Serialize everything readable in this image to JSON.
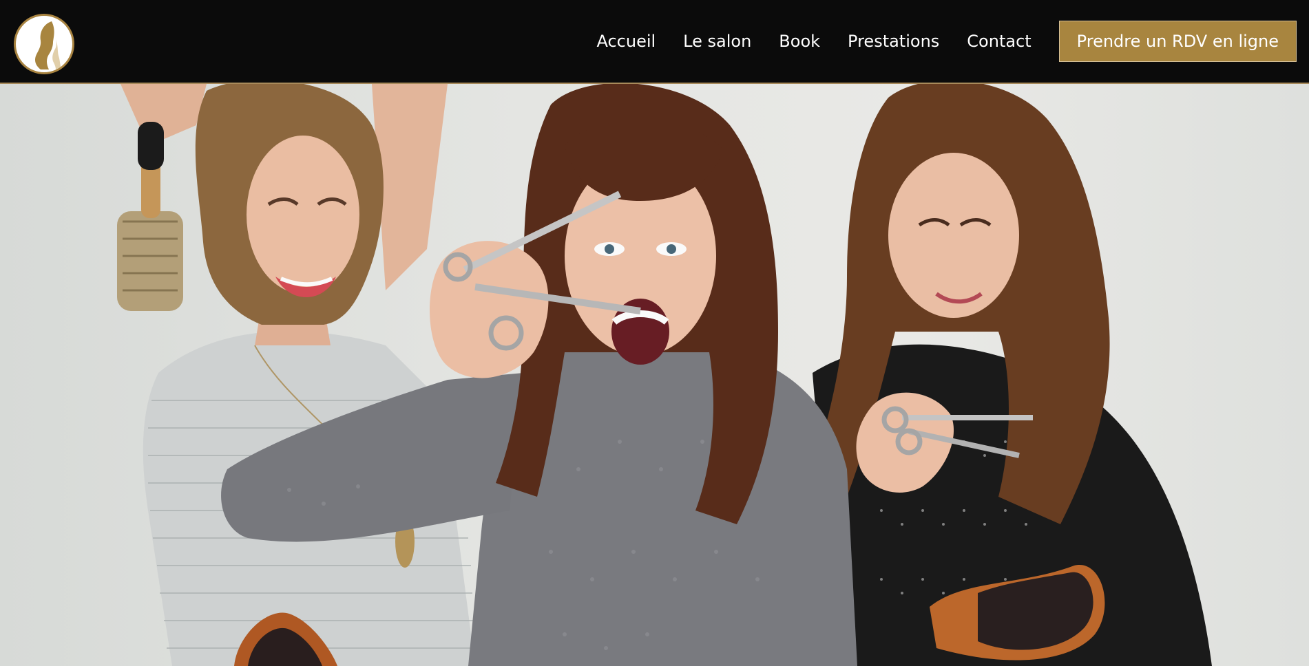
{
  "header": {
    "logo_name": "salon-logo-woman-profile",
    "nav": [
      {
        "label": "Accueil"
      },
      {
        "label": "Le salon"
      },
      {
        "label": "Book"
      },
      {
        "label": "Prestations"
      },
      {
        "label": "Contact"
      }
    ],
    "cta_label": "Prendre un RDV en ligne"
  },
  "colors": {
    "header_bg": "#0b0b0b",
    "accent_gold": "#a8853f",
    "nav_text": "#ffffff"
  }
}
